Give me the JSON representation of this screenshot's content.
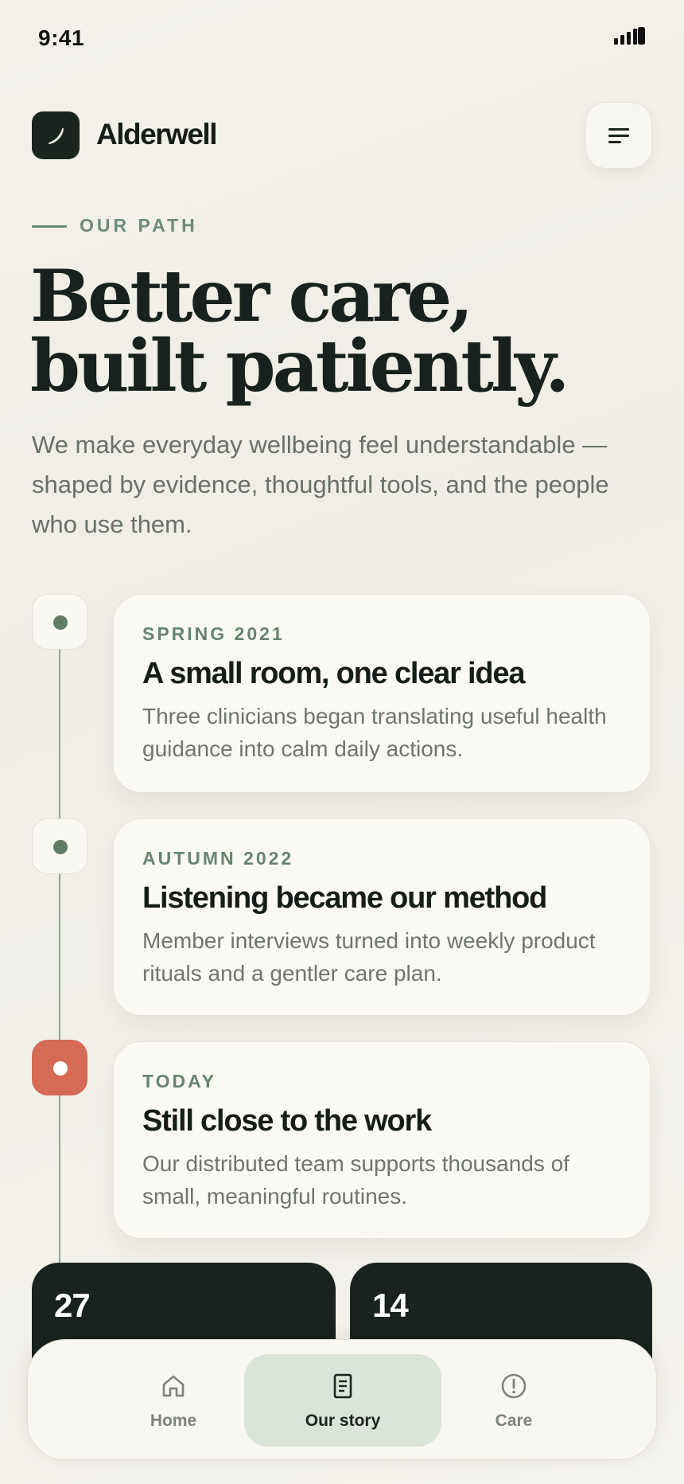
{
  "status_bar": {
    "time": "9:41"
  },
  "header": {
    "brand": "Alderwell"
  },
  "eyebrow": "OUR PATH",
  "hero": {
    "title_line1": "Better care,",
    "title_line2": "built patiently.",
    "intro": "We make everyday wellbeing feel understandable —shaped by evidence, thoughtful tools, and the people who use them."
  },
  "timeline": [
    {
      "when": "SPRING 2021",
      "title": "A small room, one clear idea",
      "body": "Three clinicians began translating useful health guidance into calm daily actions."
    },
    {
      "when": "AUTUMN 2022",
      "title": "Listening became our method",
      "body": "Member interviews turned into weekly product rituals and a gentler care plan."
    },
    {
      "when": "TODAY",
      "title": "Still close to the work",
      "body": "Our distributed team supports thousands of small, meaningful routines."
    }
  ],
  "stats": [
    {
      "value": "27"
    },
    {
      "value": "14"
    }
  ],
  "tabs": [
    {
      "label": "Home",
      "icon": "home-icon",
      "active": false
    },
    {
      "label": "Our story",
      "icon": "document-icon",
      "active": true
    },
    {
      "label": "Care",
      "icon": "alert-circle-icon",
      "active": false
    }
  ],
  "colors": {
    "accent_green": "#6d8b73",
    "dark": "#19221e",
    "current_node": "#d56a55",
    "active_tab_bg": "#dbe4d8",
    "background": "#f2f0e9"
  }
}
